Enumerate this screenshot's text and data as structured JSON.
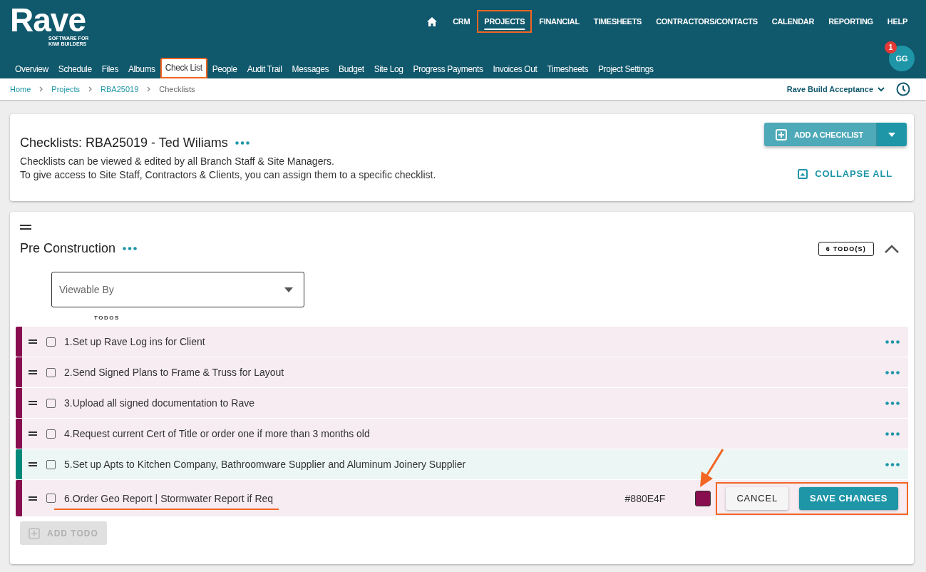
{
  "logo": {
    "name": "Rave",
    "tagline": "SOFTWARE FOR KIWI BUILDERS"
  },
  "main_nav": [
    {
      "kind": "home"
    },
    {
      "kind": "text",
      "label": "CRM",
      "selected": false,
      "highlighted": false
    },
    {
      "kind": "text",
      "label": "PROJECTS",
      "selected": true,
      "highlighted": true
    },
    {
      "kind": "text",
      "label": "FINANCIAL",
      "selected": false,
      "highlighted": false
    },
    {
      "kind": "text",
      "label": "TIMESHEETS",
      "selected": false,
      "highlighted": false
    },
    {
      "kind": "text",
      "label": "CONTRACTORS/CONTACTS",
      "selected": false,
      "highlighted": false
    },
    {
      "kind": "text",
      "label": "CALENDAR",
      "selected": false,
      "highlighted": false
    },
    {
      "kind": "text",
      "label": "REPORTING",
      "selected": false,
      "highlighted": false
    },
    {
      "kind": "text",
      "label": "HELP",
      "selected": false,
      "highlighted": false
    }
  ],
  "avatar": {
    "initials": "GG",
    "badge": "1"
  },
  "tabs": [
    {
      "label": "Overview",
      "selected": false,
      "highlighted": false
    },
    {
      "label": "Schedule",
      "selected": false,
      "highlighted": false
    },
    {
      "label": "Files",
      "selected": false,
      "highlighted": false
    },
    {
      "label": "Albums",
      "selected": false,
      "highlighted": false
    },
    {
      "label": "Check List",
      "selected": true,
      "highlighted": true
    },
    {
      "label": "People",
      "selected": false,
      "highlighted": false
    },
    {
      "label": "Audit Trail",
      "selected": false,
      "highlighted": false
    },
    {
      "label": "Messages",
      "selected": false,
      "highlighted": false
    },
    {
      "label": "Budget",
      "selected": false,
      "highlighted": false
    },
    {
      "label": "Site Log",
      "selected": false,
      "highlighted": false
    },
    {
      "label": "Progress Payments",
      "selected": false,
      "highlighted": false
    },
    {
      "label": "Invoices Out",
      "selected": false,
      "highlighted": false
    },
    {
      "label": "Timesheets",
      "selected": false,
      "highlighted": false
    },
    {
      "label": "Project Settings",
      "selected": false,
      "highlighted": false
    }
  ],
  "breadcrumb": [
    "Home",
    "Projects",
    "RBA25019",
    "Checklists"
  ],
  "template_select": "Rave Build Acceptance",
  "header_card": {
    "title": "Checklists: RBA25019 - Ted Wiliams",
    "lines": [
      "Checklists can be viewed & edited by all Branch Staff & Site Managers.",
      "To give access to Site Staff, Contractors & Clients, you can assign them to a specific checklist."
    ],
    "add_button": "ADD A CHECKLIST",
    "collapse_button": "COLLAPSE ALL"
  },
  "checklist": {
    "title": "Pre Construction",
    "count": "6 TODO(S)",
    "expanded": true,
    "viewable_by": {
      "placeholder": "Viewable By"
    },
    "todos_label": "TODOS",
    "todos": [
      {
        "text": "1.Set up Rave Log ins for Client",
        "checked": false,
        "color": "#880e4f",
        "editing": false
      },
      {
        "text": "2.Send Signed Plans to Frame & Truss for Layout",
        "checked": false,
        "color": "#880e4f",
        "editing": false
      },
      {
        "text": "3.Upload all signed documentation to Rave",
        "checked": false,
        "color": "#880e4f",
        "editing": false
      },
      {
        "text": "4.Request current Cert of Title or order one if more than 3 months old",
        "checked": false,
        "color": "#880e4f",
        "editing": false
      },
      {
        "text": "5.Set up Apts to Kitchen Company, Bathroomware Supplier and Aluminum Joinery Supplier",
        "checked": false,
        "color": "#00897b",
        "editing": false
      },
      {
        "text": "6.Order Geo Report | Stormwater Report if Req",
        "checked": false,
        "color": "#880e4f",
        "editing": true,
        "color_code": "#880E4F",
        "cancel": "CANCEL",
        "save": "SAVE CHANGES",
        "highlighted": true
      }
    ],
    "add_todo": {
      "label": "ADD TODO",
      "disabled": true
    }
  }
}
